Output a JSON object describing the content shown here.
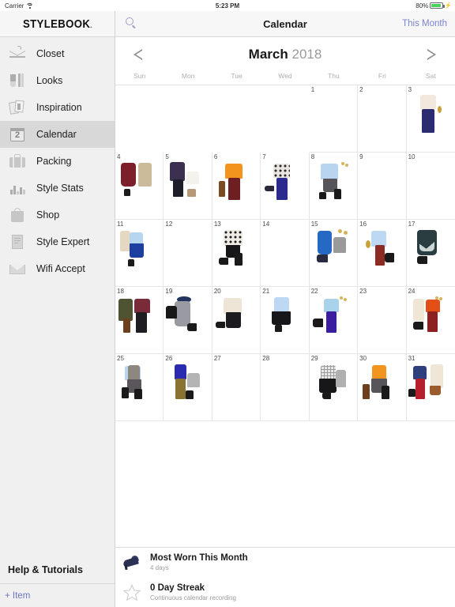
{
  "status_bar": {
    "carrier": "Carrier",
    "wifi_icon": "wifi-icon",
    "time": "5:23 PM",
    "battery_percent": "80%",
    "battery_icon": "battery-icon",
    "charging_icon": "charging-bolt-icon"
  },
  "sidebar": {
    "brand": "STYLEBOOK",
    "brand_mark": ".",
    "items": [
      {
        "label": "Closet",
        "icon": "hanger-icon",
        "active": false
      },
      {
        "label": "Looks",
        "icon": "clothing-rack-icon",
        "active": false
      },
      {
        "label": "Inspiration",
        "icon": "photos-icon",
        "active": false
      },
      {
        "label": "Calendar",
        "icon": "calendar-icon",
        "active": true
      },
      {
        "label": "Packing",
        "icon": "suitcase-icon",
        "active": false
      },
      {
        "label": "Style Stats",
        "icon": "bar-chart-icon",
        "active": false
      },
      {
        "label": "Shop",
        "icon": "shopping-bag-icon",
        "active": false
      },
      {
        "label": "Style Expert",
        "icon": "article-card-icon",
        "active": false
      },
      {
        "label": "Wifi Accept",
        "icon": "envelope-icon",
        "active": false
      }
    ],
    "help": "Help & Tutorials",
    "add_item": "+ Item"
  },
  "navbar": {
    "search_icon": "search-icon",
    "title": "Calendar",
    "this_month": "This Month"
  },
  "calendar": {
    "prev_icon": "chevron-left-icon",
    "next_icon": "chevron-right-icon",
    "month": "March",
    "year": "2018",
    "weekdays": [
      "Sun",
      "Mon",
      "Tue",
      "Wed",
      "Thu",
      "Fri",
      "Sat"
    ],
    "lead_blanks": 4,
    "days": [
      {
        "n": 1,
        "outfit": null
      },
      {
        "n": 2,
        "outfit": null
      },
      {
        "n": 3,
        "outfit": "cream-blouse-navy-trousers-necklace"
      },
      {
        "n": 4,
        "outfit": "red-plaid-dress-tan-coat-black-booties"
      },
      {
        "n": 5,
        "outfit": "printed-jacket-white-sweater-black-pants-tan-booties"
      },
      {
        "n": 6,
        "outfit": "orange-turtleneck-burgundy-pants-brown-boots"
      },
      {
        "n": 7,
        "outfit": "print-top-navy-pants-flats"
      },
      {
        "n": 8,
        "outfit": "blue-shirt-gray-skirt-black-booties-earrings"
      },
      {
        "n": 9,
        "outfit": null
      },
      {
        "n": 10,
        "outfit": null
      },
      {
        "n": 11,
        "outfit": "trench-blue-sweater-blue-skirt-bootie"
      },
      {
        "n": 12,
        "outfit": null
      },
      {
        "n": 13,
        "outfit": "leopard-top-black-skirt-pumps-boots"
      },
      {
        "n": 14,
        "outfit": null
      },
      {
        "n": 15,
        "outfit": "blue-dress-gray-cardigan-pumps-earrings"
      },
      {
        "n": 16,
        "outfit": "blue-shirt-red-pants-heels-necklace"
      },
      {
        "n": 17,
        "outfit": "print-dress-black-heels"
      },
      {
        "n": 18,
        "outfit": "olive-parka-fair-isle-sweater-black-pants-boots"
      },
      {
        "n": 19,
        "outfit": "navy-hat-gray-dress-black-cardigan-heels"
      },
      {
        "n": 20,
        "outfit": "cream-sweater-black-skirt-flats"
      },
      {
        "n": 21,
        "outfit": "blue-shirt-black-skirt-booties"
      },
      {
        "n": 22,
        "outfit": "light-blue-top-purple-pants-heels-earrings"
      },
      {
        "n": 23,
        "outfit": null
      },
      {
        "n": 24,
        "outfit": "cream-vest-orange-sweater-red-pants-heels-earrings"
      },
      {
        "n": 25,
        "outfit": "fur-vest-blue-shirt-gray-skirt-black-boots"
      },
      {
        "n": 26,
        "outfit": "blue-tank-olive-pants-gray-sweater-booties"
      },
      {
        "n": 27,
        "outfit": null
      },
      {
        "n": 28,
        "outfit": null
      },
      {
        "n": 29,
        "outfit": "check-top-black-skirt-gray-cardigan-heels"
      },
      {
        "n": 30,
        "outfit": "orange-turtleneck-gray-skirt-brown-boots-black-boots"
      },
      {
        "n": 31,
        "outfit": "navy-sweater-red-pants-trench-brown-bag-booties"
      }
    ]
  },
  "bottom_panel": {
    "rows": [
      {
        "icon": "navy-heel-shoe-icon",
        "title": "Most Worn This Month",
        "subtitle": "4 days"
      },
      {
        "icon": "star-outline-icon",
        "title": "0 Day Streak",
        "subtitle": "Continuous calendar recording"
      }
    ]
  },
  "colors": {
    "accent": "#7b83cf",
    "sidebar_bg": "#f0f0f0",
    "active_bg": "#d8d8d8",
    "battery_green": "#4cd35e"
  }
}
